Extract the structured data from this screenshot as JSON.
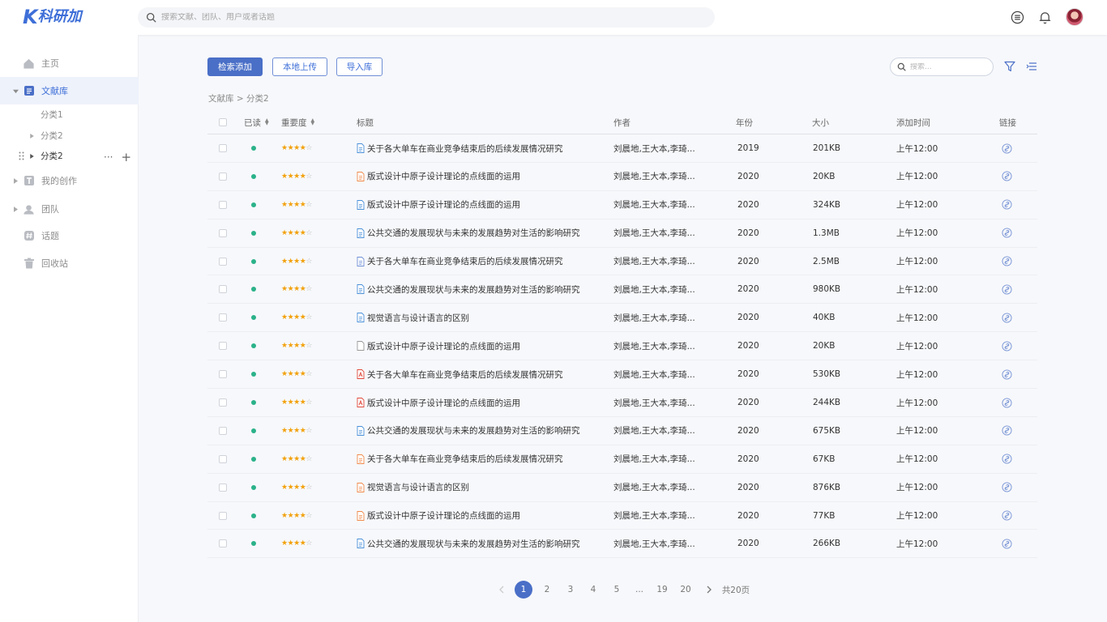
{
  "header": {
    "logo_k": "K",
    "logo_text": "科研加",
    "search_placeholder": "搜索文献、团队、用户或者话题",
    "icons": [
      "menu-icon",
      "bell-icon"
    ]
  },
  "sidebar": {
    "items": [
      {
        "label": "主页",
        "icon": "home-icon"
      },
      {
        "label": "文献库",
        "icon": "document-icon",
        "active": true
      },
      {
        "label": "我的创作",
        "icon": "text-icon"
      },
      {
        "label": "团队",
        "icon": "team-icon"
      },
      {
        "label": "话题",
        "icon": "hash-icon"
      },
      {
        "label": "回收站",
        "icon": "trash-icon"
      }
    ],
    "subitems": [
      {
        "label": "分类1"
      },
      {
        "label": "分类2"
      },
      {
        "label": "分类2"
      }
    ],
    "sub_more": "···",
    "sub_add": "+"
  },
  "toolbar": {
    "search_add": "检索添加",
    "local_upload": "本地上传",
    "import_lib": "导入库",
    "search_placeholder": "搜索..."
  },
  "breadcrumb": "文献库 > 分类2",
  "table": {
    "columns": {
      "read": "已读",
      "importance": "重要度",
      "title": "标题",
      "author": "作者",
      "year": "年份",
      "size": "大小",
      "added": "添加时间",
      "link": "链接"
    },
    "rows": [
      {
        "title": "关于各大单车在商业竞争结束后的后续发展情况研究",
        "author": "刘晨地,王大本,李琦...",
        "year": "2019",
        "size": "201KB",
        "added": "上午12:00",
        "stars": 4,
        "file_type": "doc",
        "file_color": "#4a90d9"
      },
      {
        "title": "版式设计中原子设计理论的点线面的运用",
        "author": "刘晨地,王大本,李琦...",
        "year": "2020",
        "size": "20KB",
        "added": "上午12:00",
        "stars": 4,
        "file_type": "doc",
        "file_color": "#f08a4b"
      },
      {
        "title": "版式设计中原子设计理论的点线面的运用",
        "author": "刘晨地,王大本,李琦...",
        "year": "2020",
        "size": "324KB",
        "added": "上午12:00",
        "stars": 4,
        "file_type": "doc",
        "file_color": "#4a90d9"
      },
      {
        "title": "公共交通的发展现状与未来的发展趋势对生活的影响研究",
        "author": "刘晨地,王大本,李琦...",
        "year": "2020",
        "size": "1.3MB",
        "added": "上午12:00",
        "stars": 4,
        "file_type": "doc",
        "file_color": "#4a90d9"
      },
      {
        "title": "关于各大单车在商业竞争结束后的后续发展情况研究",
        "author": "刘晨地,王大本,李琦...",
        "year": "2020",
        "size": "2.5MB",
        "added": "上午12:00",
        "stars": 4,
        "file_type": "doc",
        "file_color": "#6f8fd6"
      },
      {
        "title": "公共交通的发展现状与未来的发展趋势对生活的影响研究",
        "author": "刘晨地,王大本,李琦...",
        "year": "2020",
        "size": "980KB",
        "added": "上午12:00",
        "stars": 4,
        "file_type": "doc",
        "file_color": "#4a90d9"
      },
      {
        "title": "视觉语言与设计语言的区别",
        "author": "刘晨地,王大本,李琦...",
        "year": "2020",
        "size": "40KB",
        "added": "上午12:00",
        "stars": 4,
        "file_type": "doc",
        "file_color": "#4a90d9"
      },
      {
        "title": "版式设计中原子设计理论的点线面的运用",
        "author": "刘晨地,王大本,李琦...",
        "year": "2020",
        "size": "20KB",
        "added": "上午12:00",
        "stars": 4,
        "file_type": "blank",
        "file_color": "#999999"
      },
      {
        "title": "关于各大单车在商业竞争结束后的后续发展情况研究",
        "author": "刘晨地,王大本,李琦...",
        "year": "2020",
        "size": "530KB",
        "added": "上午12:00",
        "stars": 4,
        "file_type": "pdf",
        "file_color": "#e0493c"
      },
      {
        "title": "版式设计中原子设计理论的点线面的运用",
        "author": "刘晨地,王大本,李琦...",
        "year": "2020",
        "size": "244KB",
        "added": "上午12:00",
        "stars": 4,
        "file_type": "pdf",
        "file_color": "#e0493c"
      },
      {
        "title": "公共交通的发展现状与未来的发展趋势对生活的影响研究",
        "author": "刘晨地,王大本,李琦...",
        "year": "2020",
        "size": "675KB",
        "added": "上午12:00",
        "stars": 4,
        "file_type": "doc",
        "file_color": "#4a90d9"
      },
      {
        "title": "关于各大单车在商业竞争结束后的后续发展情况研究",
        "author": "刘晨地,王大本,李琦...",
        "year": "2020",
        "size": "67KB",
        "added": "上午12:00",
        "stars": 4,
        "file_type": "doc",
        "file_color": "#f08a4b"
      },
      {
        "title": "视觉语言与设计语言的区别",
        "author": "刘晨地,王大本,李琦...",
        "year": "2020",
        "size": "876KB",
        "added": "上午12:00",
        "stars": 4,
        "file_type": "doc",
        "file_color": "#f08a4b"
      },
      {
        "title": "版式设计中原子设计理论的点线面的运用",
        "author": "刘晨地,王大本,李琦...",
        "year": "2020",
        "size": "77KB",
        "added": "上午12:00",
        "stars": 4,
        "file_type": "doc",
        "file_color": "#f08a4b"
      },
      {
        "title": "公共交通的发展现状与未来的发展趋势对生活的影响研究",
        "author": "刘晨地,王大本,李琦...",
        "year": "2020",
        "size": "266KB",
        "added": "上午12:00",
        "stars": 4,
        "file_type": "doc",
        "file_color": "#4a90d9"
      }
    ]
  },
  "pagination": {
    "pages": [
      "1",
      "2",
      "3",
      "4",
      "5",
      "...",
      "19",
      "20"
    ],
    "current": "1",
    "total": "共20页"
  },
  "colors": {
    "accent": "#4a6fc7",
    "read_dot": "#2bb28a",
    "star": "#f2a10c"
  }
}
